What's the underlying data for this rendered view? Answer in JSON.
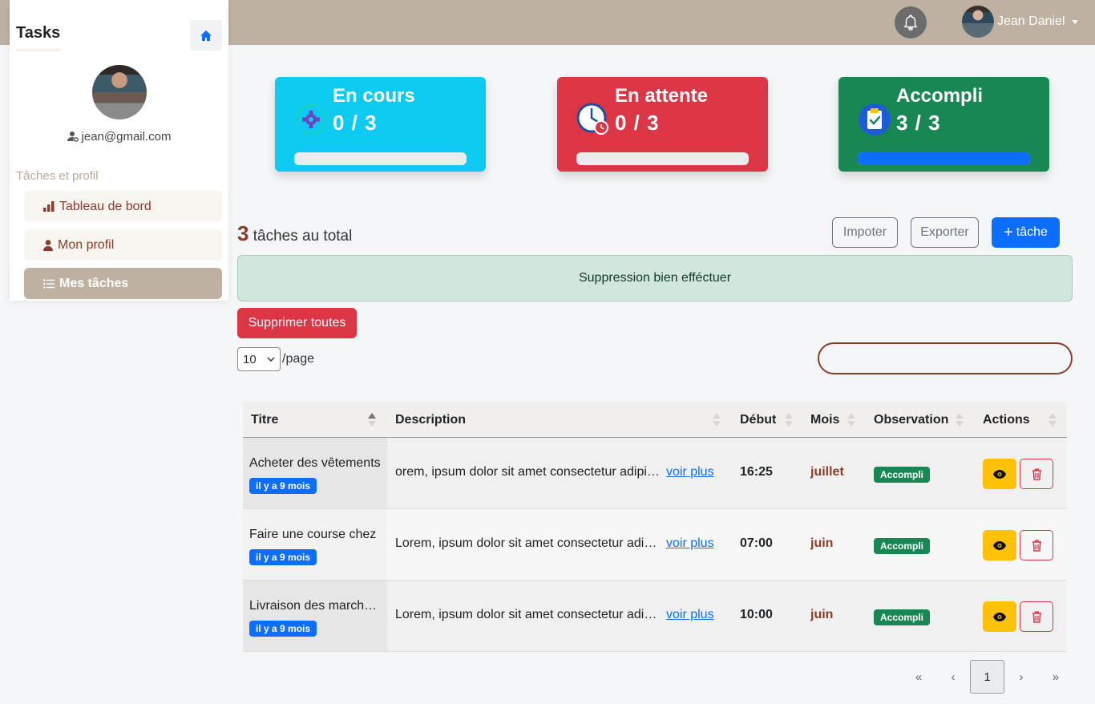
{
  "topbar": {
    "user_name": "Jean Daniel"
  },
  "sidebar": {
    "brand": "Tasks",
    "email": "jean@gmail.com",
    "section_label": "Tâches et profil",
    "items": [
      {
        "label": "Tableau de bord",
        "icon": "bar-chart-icon"
      },
      {
        "label": "Mon profil",
        "icon": "user-icon"
      },
      {
        "label": "Mes tâches",
        "icon": "list-icon",
        "active": true
      }
    ]
  },
  "cards": [
    {
      "title": "En cours",
      "count": "0 / 3",
      "progress": 0,
      "color": "#0dcaf0",
      "icon": "gear-icon"
    },
    {
      "title": "En attente",
      "count": "0 / 3",
      "progress": 0,
      "color": "#dc3545",
      "icon": "clock-icon"
    },
    {
      "title": "Accompli",
      "count": "3 / 3",
      "progress": 1,
      "color": "#198754",
      "icon": "clipboard-check-icon"
    }
  ],
  "summary": {
    "total": "3",
    "total_label": "tâches au total"
  },
  "buttons": {
    "import": "Impoter",
    "export": "Exporter",
    "add_task": "tâche",
    "delete_all": "Supprimer toutes"
  },
  "alert": {
    "message": "Suppression bien efféctuer"
  },
  "perpage": {
    "value": "10",
    "suffix": "/page"
  },
  "search": {
    "value": ""
  },
  "table": {
    "columns": [
      "Titre",
      "Description",
      "Début",
      "Mois",
      "Observation",
      "Actions"
    ],
    "rows": [
      {
        "titre": "Acheter des vêtements",
        "age": "il y a 9 mois",
        "description": "orem, ipsum dolor sit amet consectetur adipisicing",
        "more": "voir plus",
        "debut": "16:25",
        "mois": "juillet",
        "observation": "Accompli"
      },
      {
        "titre": "Faire une course chez",
        "age": "il y a 9 mois",
        "description": "Lorem, ipsum dolor sit amet consectetur adipisicing",
        "more": "voir plus",
        "debut": "07:00",
        "mois": "juin",
        "observation": "Accompli"
      },
      {
        "titre": "Livraison des marchandises",
        "age": "il y a 9 mois",
        "description": "Lorem, ipsum dolor sit amet consectetur adipisicing",
        "more": "voir plus",
        "debut": "10:00",
        "mois": "juin",
        "observation": "Accompli"
      }
    ]
  },
  "pagination": {
    "first": "«",
    "prev": "‹",
    "current": "1",
    "next": "›",
    "last": "»"
  }
}
